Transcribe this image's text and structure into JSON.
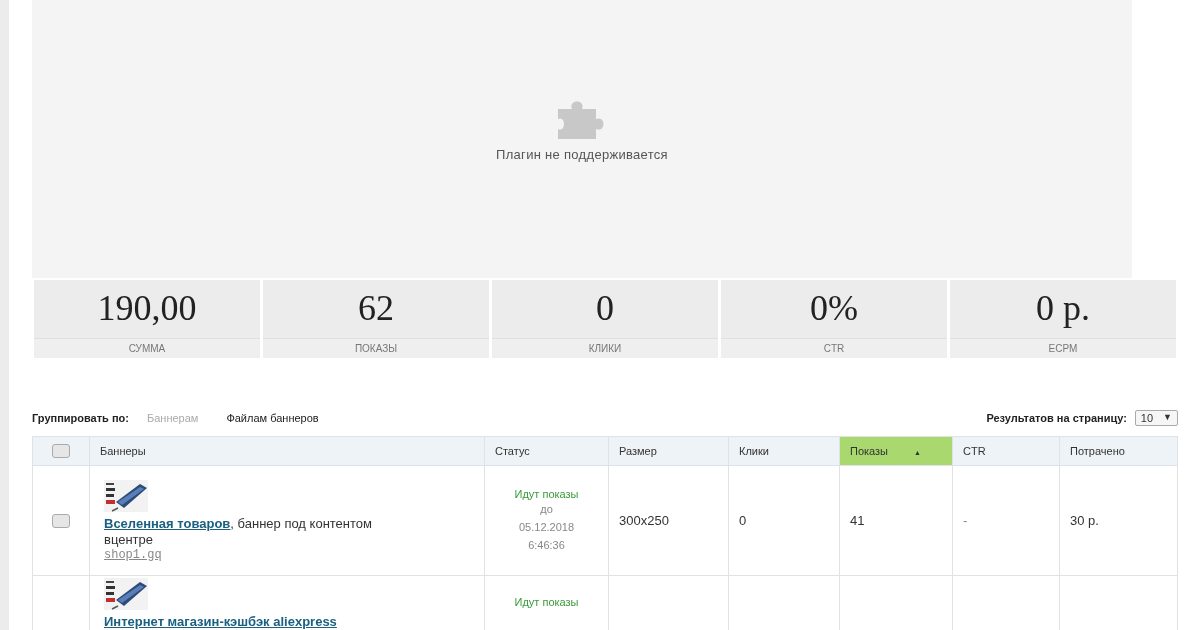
{
  "plugin": {
    "message": "Плагин не поддерживается"
  },
  "stats": [
    {
      "value": "190,00",
      "label": "СУММА"
    },
    {
      "value": "62",
      "label": "ПОКАЗЫ"
    },
    {
      "value": "0",
      "label": "КЛИКИ"
    },
    {
      "value": "0%",
      "label": "CTR"
    },
    {
      "value": "0 р.",
      "label": "ECPM"
    }
  ],
  "group_by": {
    "label": "Группировать по:",
    "options": [
      {
        "label": "Баннерам",
        "selected": true
      },
      {
        "label": "Файлам баннеров",
        "selected": false
      }
    ]
  },
  "per_page": {
    "label": "Результатов на страницу:",
    "value": "10",
    "caret": "▼"
  },
  "table": {
    "select_all": {
      "checked": false
    },
    "columns": [
      {
        "label": "Баннеры",
        "sorted": false
      },
      {
        "label": "Статус",
        "sorted": false
      },
      {
        "label": "Размер",
        "sorted": false
      },
      {
        "label": "Клики",
        "sorted": false
      },
      {
        "label": "Показы",
        "sorted": true,
        "sort_icon": "▲"
      },
      {
        "label": "CTR",
        "sorted": false
      },
      {
        "label": "Потрачено",
        "sorted": false
      }
    ],
    "rows": [
      {
        "checked": false,
        "title_link": "Вселенная товаров",
        "title_rest": ", баннер под контентом вцентре",
        "site": "shop1.gq",
        "status": "Идут показы",
        "until": [
          "до",
          "05.12.2018",
          "6:46:36"
        ],
        "size": "300x250",
        "clicks": "0",
        "shows": "41",
        "ctr": "-",
        "spent": "30 р."
      },
      {
        "title_link": "Интернет магазин-кэшбэк aliexpress",
        "status": "Идут показы"
      }
    ]
  }
}
